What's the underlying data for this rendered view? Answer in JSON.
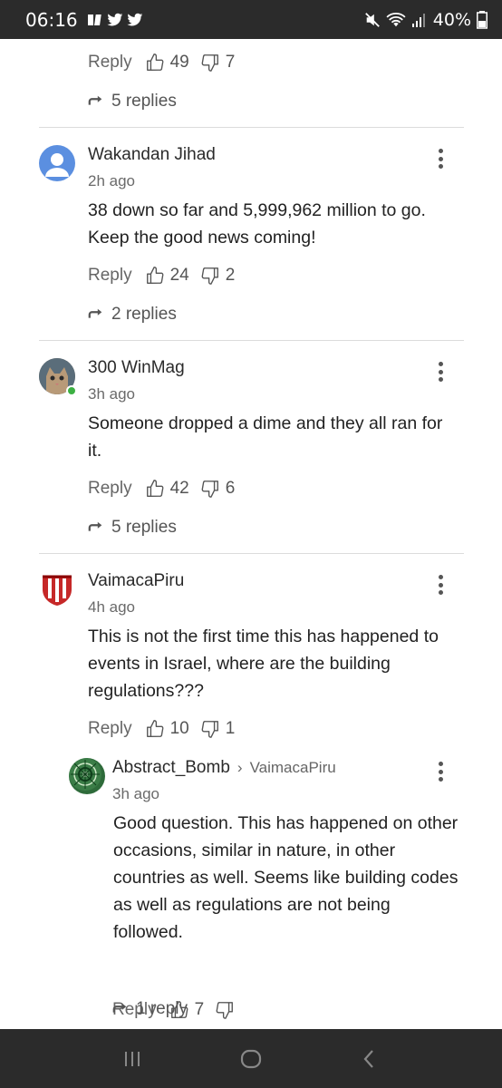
{
  "status_bar": {
    "time": "06:16",
    "battery": "40%",
    "icons": [
      "media-icon",
      "twitter-icon",
      "twitter-icon",
      "mute-icon",
      "wifi-icon",
      "signal-icon",
      "battery-icon"
    ]
  },
  "top_partial": {
    "reply_label": "Reply",
    "likes": "49",
    "dislikes": "7",
    "replies": "5 replies"
  },
  "comments": [
    {
      "author": "Wakandan Jihad",
      "ago": "2h ago",
      "body": "38 down so far and 5,999,962 million to go. Keep the good news coming!",
      "reply_label": "Reply",
      "likes": "24",
      "dislikes": "2",
      "replies": "2 replies"
    },
    {
      "author": "300 WinMag",
      "ago": "3h ago",
      "body": "Someone dropped a dime and they all ran for it.",
      "reply_label": "Reply",
      "likes": "42",
      "dislikes": "6",
      "replies": "5 replies"
    },
    {
      "author": "VaimacaPiru",
      "ago": "4h ago",
      "body": "This is not the first time this has happened to events in Israel, where are the building regulations???",
      "reply_label": "Reply",
      "likes": "10",
      "dislikes": "1"
    }
  ],
  "nested_reply": {
    "author": "Abstract_Bomb",
    "reply_to": "VaimacaPiru",
    "ago": "3h ago",
    "body": "Good question.  This has happened on other occasions, similar in nature, in other countries as well.  Seems like building codes as well as regulations are not being followed.",
    "reply_label": "Reply",
    "likes": "7",
    "dislikes": "",
    "replies": "1 reply"
  },
  "colors": {
    "status_bar_bg": "#2b2b2b",
    "online_dot": "#3cb043",
    "default_avatar": "#5b8fe0"
  }
}
